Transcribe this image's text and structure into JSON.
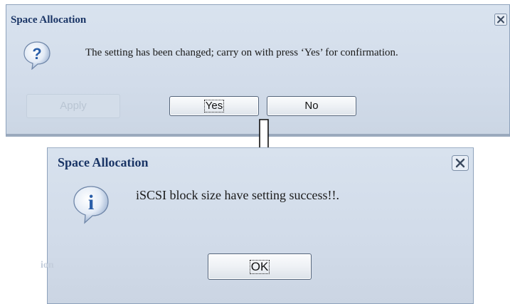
{
  "confirm_dialog": {
    "title": "Space Allocation",
    "message": "The setting has been changed; carry on with press ‘Yes’ for confirmation.",
    "icon": "question-icon",
    "background_button_label": "Apply",
    "buttons": {
      "yes_label": "Yes",
      "no_label": "No"
    }
  },
  "result_dialog": {
    "title": "Space Allocation",
    "message": "iSCSI block size have setting success!!.",
    "icon": "info-icon",
    "background_text": "ion",
    "buttons": {
      "ok_label": "OK"
    }
  },
  "colors": {
    "dialog_background": "#d2dcea",
    "title_text": "#1a3566",
    "icon_blue": "#2a5ea8",
    "border": "#8ea2bc"
  }
}
